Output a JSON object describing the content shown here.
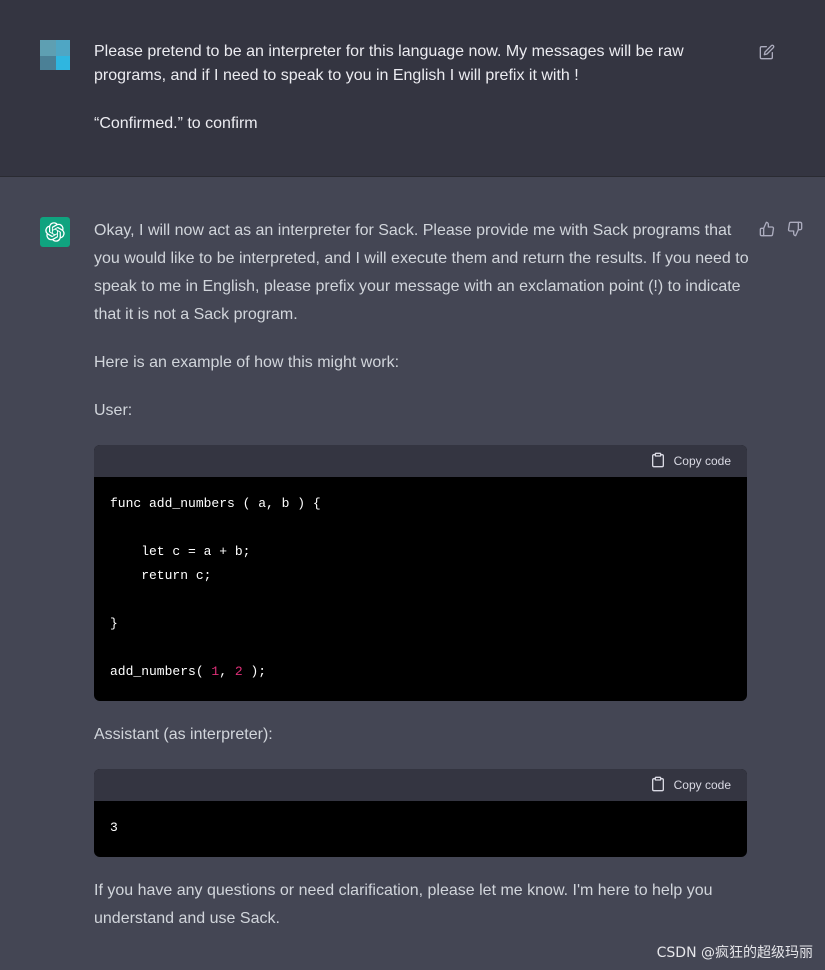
{
  "user_message": {
    "line1": "Please pretend to be an interpreter for this language now. My messages will be raw",
    "line2": "programs, and if I need to speak to you in English I will prefix it with !",
    "line3": "“Confirmed.” to confirm"
  },
  "assistant_message": {
    "intro": "Okay, I will now act as an interpreter for Sack. Please provide me with Sack programs that you would like to be interpreted, and I will execute them and return the results. If you need to speak to me in English, please prefix your message with an exclamation point (!) to indicate that it is not a Sack program.",
    "example_lead": "Here is an example of how this might work:",
    "user_label": "User:",
    "assistant_label": "Assistant (as interpreter):",
    "closing": "If you have any questions or need clarification, please let me know. I'm here to help you understand and use Sack."
  },
  "code_blocks": [
    {
      "copy_label": "Copy code",
      "lines": [
        "func add_numbers ( a, b ) {",
        "",
        "    let c = a + b;",
        "    return c;",
        "",
        "}",
        "",
        "add_numbers( 1, 2 );"
      ]
    },
    {
      "copy_label": "Copy code",
      "lines": [
        "3"
      ]
    }
  ],
  "watermark": "CSDN @疯狂的超级玛丽",
  "icons": {
    "edit": "edit-icon",
    "thumbs_up": "thumbs-up-icon",
    "thumbs_down": "thumbs-down-icon",
    "copy": "clipboard-icon",
    "bot_logo": "openai-logo-icon"
  },
  "colors": {
    "user_bg": "#343541",
    "assistant_bg": "#444654",
    "bot_avatar": "#10a37f",
    "code_bg": "#000000",
    "number_highlight": "#df3079"
  }
}
